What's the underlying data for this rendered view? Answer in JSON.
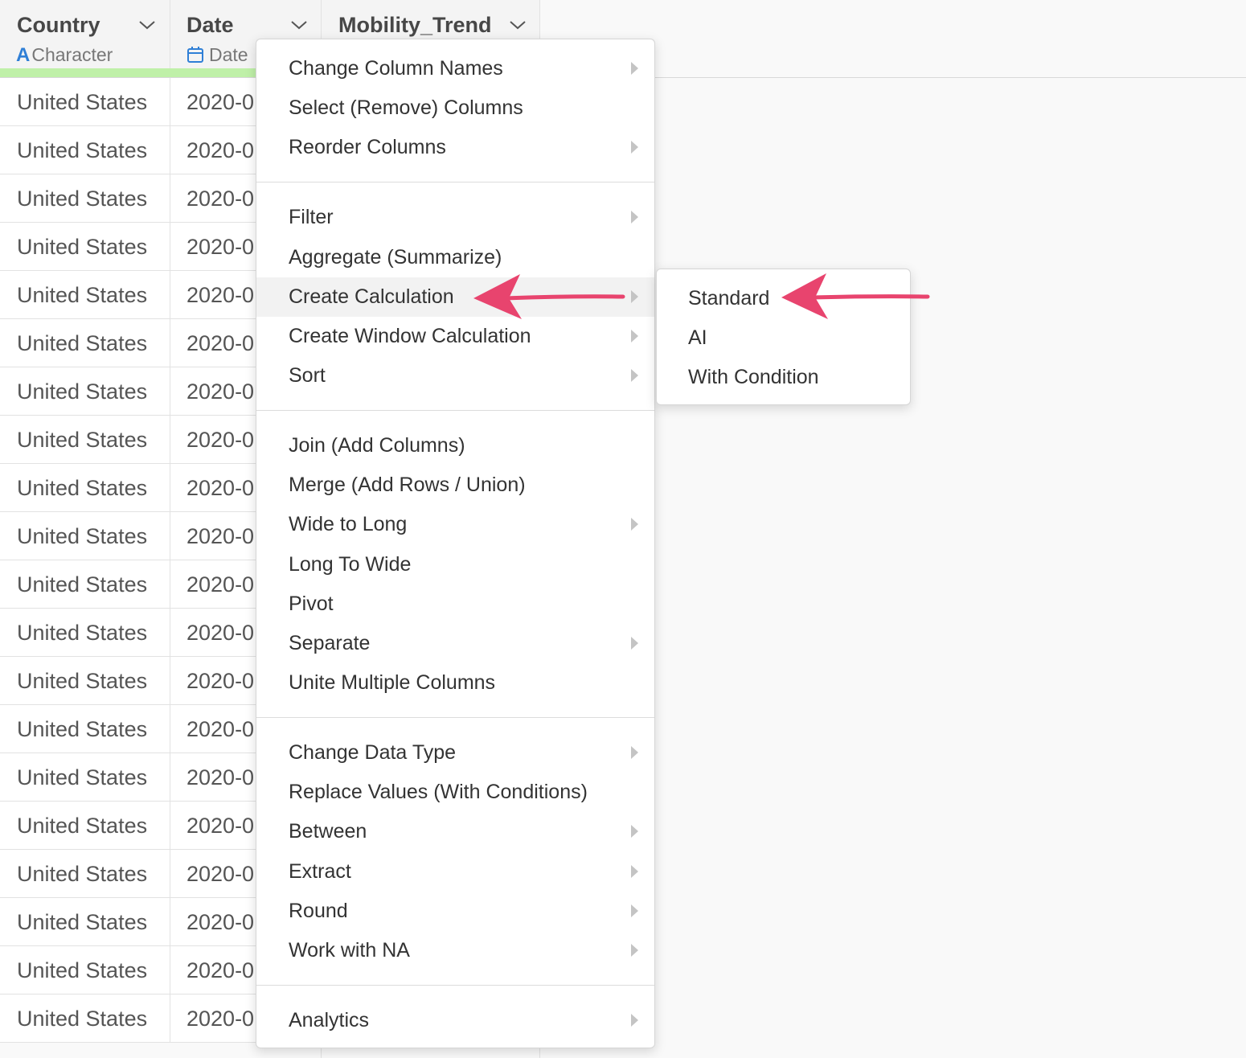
{
  "table": {
    "columns": [
      {
        "name": "Country",
        "type_label": "Character",
        "type_icon": "A"
      },
      {
        "name": "Date",
        "type_label": "Date"
      },
      {
        "name": "Mobility_Trend"
      }
    ],
    "rows": [
      {
        "country": "United States",
        "date": "2020-0"
      },
      {
        "country": "United States",
        "date": "2020-0"
      },
      {
        "country": "United States",
        "date": "2020-0"
      },
      {
        "country": "United States",
        "date": "2020-0"
      },
      {
        "country": "United States",
        "date": "2020-0"
      },
      {
        "country": "United States",
        "date": "2020-0"
      },
      {
        "country": "United States",
        "date": "2020-0"
      },
      {
        "country": "United States",
        "date": "2020-0"
      },
      {
        "country": "United States",
        "date": "2020-0"
      },
      {
        "country": "United States",
        "date": "2020-0"
      },
      {
        "country": "United States",
        "date": "2020-0"
      },
      {
        "country": "United States",
        "date": "2020-0"
      },
      {
        "country": "United States",
        "date": "2020-0"
      },
      {
        "country": "United States",
        "date": "2020-0"
      },
      {
        "country": "United States",
        "date": "2020-0"
      },
      {
        "country": "United States",
        "date": "2020-0"
      },
      {
        "country": "United States",
        "date": "2020-0"
      },
      {
        "country": "United States",
        "date": "2020-0"
      },
      {
        "country": "United States",
        "date": "2020-0"
      },
      {
        "country": "United States",
        "date": "2020-0"
      }
    ]
  },
  "menu": {
    "items": [
      {
        "label": "Change Column Names",
        "submenu": true
      },
      {
        "label": "Select (Remove) Columns",
        "submenu": false
      },
      {
        "label": "Reorder Columns",
        "submenu": true
      },
      {
        "label": "Filter",
        "submenu": true
      },
      {
        "label": "Aggregate (Summarize)",
        "submenu": false
      },
      {
        "label": "Create Calculation",
        "submenu": true,
        "active": true
      },
      {
        "label": "Create Window Calculation",
        "submenu": true
      },
      {
        "label": "Sort",
        "submenu": true
      },
      {
        "label": "Join (Add Columns)",
        "submenu": false
      },
      {
        "label": "Merge (Add Rows / Union)",
        "submenu": false
      },
      {
        "label": "Wide to Long",
        "submenu": true
      },
      {
        "label": "Long To Wide",
        "submenu": false
      },
      {
        "label": "Pivot",
        "submenu": false
      },
      {
        "label": "Separate",
        "submenu": true
      },
      {
        "label": "Unite Multiple Columns",
        "submenu": false
      },
      {
        "label": "Change Data Type",
        "submenu": true
      },
      {
        "label": "Replace Values (With Conditions)",
        "submenu": false
      },
      {
        "label": "Between",
        "submenu": true
      },
      {
        "label": "Extract",
        "submenu": true
      },
      {
        "label": "Round",
        "submenu": true
      },
      {
        "label": "Work with NA",
        "submenu": true
      },
      {
        "label": "Analytics",
        "submenu": true
      }
    ]
  },
  "submenu": {
    "items": [
      {
        "label": "Standard"
      },
      {
        "label": "AI"
      },
      {
        "label": "With Condition"
      }
    ]
  },
  "colors": {
    "annotation_arrow": "#e8446e",
    "type_icon": "#2f7fd6",
    "header_underline": "#bff0a8"
  }
}
